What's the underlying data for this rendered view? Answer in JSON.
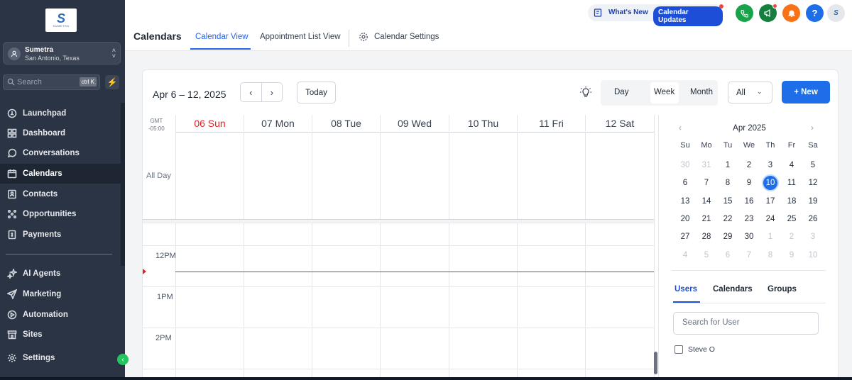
{
  "sidebar": {
    "logo_text": "SUMETRA",
    "account": {
      "name": "Sumetra",
      "location": "San Antonio, Texas"
    },
    "search": {
      "placeholder": "Search",
      "shortcut": "ctrl K"
    },
    "items_primary": [
      {
        "label": "Launchpad",
        "icon": "rocket-icon",
        "active": false
      },
      {
        "label": "Dashboard",
        "icon": "dashboard-icon",
        "active": false
      },
      {
        "label": "Conversations",
        "icon": "chat-icon",
        "active": false
      },
      {
        "label": "Calendars",
        "icon": "calendar-icon",
        "active": true
      },
      {
        "label": "Contacts",
        "icon": "contacts-icon",
        "active": false
      },
      {
        "label": "Opportunities",
        "icon": "opportunities-icon",
        "active": false
      },
      {
        "label": "Payments",
        "icon": "payments-icon",
        "active": false
      }
    ],
    "items_secondary": [
      {
        "label": "AI Agents",
        "icon": "sparkle-icon"
      },
      {
        "label": "Marketing",
        "icon": "send-icon"
      },
      {
        "label": "Automation",
        "icon": "automation-icon"
      },
      {
        "label": "Sites",
        "icon": "sites-icon"
      },
      {
        "label": "Settings",
        "icon": "gear-icon"
      }
    ]
  },
  "header": {
    "title": "Calendars",
    "tabs": [
      {
        "label": "Calendar View",
        "active": true
      },
      {
        "label": "Appointment List View",
        "active": false
      },
      {
        "label": "Calendar Settings",
        "active": false
      }
    ],
    "whats_new": "What's New",
    "calendar_updates": "Calendar Updates",
    "icons": [
      "phone-icon",
      "megaphone-icon",
      "bell-icon",
      "help-icon"
    ],
    "help_label": "?",
    "colors": {
      "phone": "#16a34a",
      "megaphone": "#15803d",
      "bell": "#f97316",
      "help": "#1d6ee8"
    }
  },
  "toolbar": {
    "range": "Apr 6 – 12, 2025",
    "prev": "‹",
    "next": "›",
    "today": "Today",
    "views": [
      "Day",
      "Week",
      "Month"
    ],
    "selected_view": "Week",
    "filter": "All",
    "new_label": "+ New"
  },
  "week": {
    "gmt": [
      "GMT",
      "-05:00"
    ],
    "days": [
      "06 Sun",
      "07 Mon",
      "08 Tue",
      "09 Wed",
      "10 Thu",
      "11 Fri",
      "12 Sat"
    ],
    "today_index": 0,
    "all_day": "All Day",
    "hours": [
      "12PM",
      "1PM",
      "2PM"
    ]
  },
  "mini_calendar": {
    "month": "Apr 2025",
    "weekdays": [
      "Su",
      "Mo",
      "Tu",
      "We",
      "Th",
      "Fr",
      "Sa"
    ],
    "weeks": [
      [
        "30",
        "31",
        "1",
        "2",
        "3",
        "4",
        "5"
      ],
      [
        "6",
        "7",
        "8",
        "9",
        "10",
        "11",
        "12"
      ],
      [
        "13",
        "14",
        "15",
        "16",
        "17",
        "18",
        "19"
      ],
      [
        "20",
        "21",
        "22",
        "23",
        "24",
        "25",
        "26"
      ],
      [
        "27",
        "28",
        "29",
        "30",
        "1",
        "2",
        "3"
      ],
      [
        "4",
        "5",
        "6",
        "7",
        "8",
        "9",
        "10"
      ]
    ],
    "selected": "10"
  },
  "filters": {
    "tabs": [
      "Users",
      "Calendars",
      "Groups"
    ],
    "active_tab": "Users",
    "search_placeholder": "Search for User",
    "users": [
      {
        "name": "Steve O",
        "checked": false
      }
    ]
  },
  "colors": {
    "accent": "#1d6ee8",
    "sidebar": "#2b3444",
    "today_red": "#dc2626"
  }
}
